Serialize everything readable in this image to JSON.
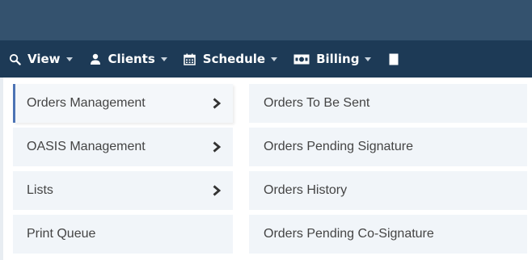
{
  "nav": {
    "items": [
      {
        "label": "View",
        "icon": "search-icon"
      },
      {
        "label": "Clients",
        "icon": "user-icon"
      },
      {
        "label": "Schedule",
        "icon": "calendar-icon"
      },
      {
        "label": "Billing",
        "icon": "money-icon"
      }
    ],
    "colors": {
      "top_strip": "#34526e",
      "bar": "#1d3a56"
    }
  },
  "menu": {
    "items": [
      {
        "label": "Orders Management",
        "has_submenu": true,
        "active": true
      },
      {
        "label": "OASIS Management",
        "has_submenu": true,
        "active": false
      },
      {
        "label": "Lists",
        "has_submenu": true,
        "active": false
      },
      {
        "label": "Print Queue",
        "has_submenu": false,
        "active": false
      }
    ],
    "accent": "#4d74b5"
  },
  "submenu": {
    "items": [
      {
        "label": "Orders To Be Sent"
      },
      {
        "label": "Orders Pending Signature"
      },
      {
        "label": "Orders History"
      },
      {
        "label": "Orders Pending Co-Signature"
      }
    ]
  }
}
